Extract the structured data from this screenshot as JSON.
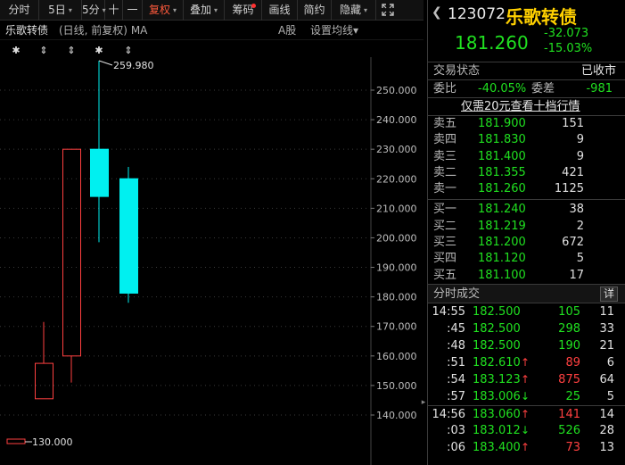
{
  "toolbar": {
    "items": [
      {
        "label": "分时",
        "has_arrow": false
      },
      {
        "label": "5日",
        "has_arrow": true
      },
      {
        "label": "5分",
        "has_arrow": true
      },
      {
        "label": "十",
        "has_arrow": false
      },
      {
        "label": "一",
        "has_arrow": false
      },
      {
        "label": "复权",
        "has_arrow": true,
        "active": true
      },
      {
        "label": "叠加",
        "has_arrow": true
      },
      {
        "label": "筹码",
        "has_arrow": false,
        "dot": true
      },
      {
        "label": "画线",
        "has_arrow": false
      },
      {
        "label": "简约",
        "has_arrow": false
      },
      {
        "label": "隐藏",
        "has_arrow": true
      }
    ],
    "fullscreen_icon": "expand-icon"
  },
  "infobar": {
    "name": "乐歌转债",
    "params": "(日线, 前复权)",
    "indicator": "MA",
    "share_type": "A股",
    "settings": "设置均线",
    "settings_arrow": "▾"
  },
  "chart_data": {
    "type": "candlestick",
    "y_ticks": [
      "250.000",
      "240.000",
      "230.000",
      "220.000",
      "210.000",
      "200.000",
      "190.000",
      "180.000",
      "170.000",
      "160.000",
      "150.000",
      "140.000"
    ],
    "y_tick_values": [
      250,
      240,
      230,
      220,
      210,
      200,
      190,
      180,
      170,
      160,
      150,
      140
    ],
    "candles": [
      {
        "open": 145.5,
        "close": 157.5,
        "high": 171.5,
        "low": 145.5,
        "dir": "up"
      },
      {
        "open": 160.0,
        "close": 230.0,
        "high": 230.0,
        "low": 151.0,
        "dir": "up"
      },
      {
        "open": 230.0,
        "close": 214.0,
        "high": 259.98,
        "low": 198.5,
        "dir": "down"
      },
      {
        "open": 220.0,
        "close": 181.26,
        "high": 224.0,
        "low": 178.0,
        "dir": "down"
      }
    ],
    "high_label": "259.980",
    "low_label": "130.000",
    "markers": [
      "✱",
      "⇕",
      "⇕",
      "✱",
      "⇕"
    ]
  },
  "quote": {
    "code": "123072",
    "name": "乐歌转债",
    "price": "181.260",
    "change": "-32.073",
    "change_pct": "-15.03%"
  },
  "status": {
    "label": "交易状态",
    "value": "已收市",
    "ratio_label": "委比",
    "ratio_value": "-40.05%",
    "diff_label": "委差",
    "diff_value": "-981"
  },
  "promo": "仅需20元查看十档行情",
  "order_book": {
    "asks": [
      {
        "label": "卖五",
        "price": "181.900",
        "vol": "151"
      },
      {
        "label": "卖四",
        "price": "181.830",
        "vol": "9"
      },
      {
        "label": "卖三",
        "price": "181.400",
        "vol": "9"
      },
      {
        "label": "卖二",
        "price": "181.355",
        "vol": "421"
      },
      {
        "label": "卖一",
        "price": "181.260",
        "vol": "1125"
      }
    ],
    "bids": [
      {
        "label": "买一",
        "price": "181.240",
        "vol": "38"
      },
      {
        "label": "买二",
        "price": "181.219",
        "vol": "2"
      },
      {
        "label": "买三",
        "price": "181.200",
        "vol": "672"
      },
      {
        "label": "买四",
        "price": "181.120",
        "vol": "5"
      },
      {
        "label": "买五",
        "price": "181.100",
        "vol": "17"
      }
    ]
  },
  "ticks": {
    "title": "分时成交",
    "detail": "详",
    "rows": [
      {
        "time": "14:55",
        "price": "182.500",
        "arrow": "",
        "vol": "105",
        "dir": "dn",
        "num": "11"
      },
      {
        "time": ":45",
        "price": "182.500",
        "arrow": "",
        "vol": "298",
        "dir": "dn",
        "num": "33"
      },
      {
        "time": ":48",
        "price": "182.500",
        "arrow": "",
        "vol": "190",
        "dir": "dn",
        "num": "21"
      },
      {
        "time": ":51",
        "price": "182.610",
        "arrow": "↑",
        "vol": "89",
        "dir": "up",
        "num": "6"
      },
      {
        "time": ":54",
        "price": "183.123",
        "arrow": "↑",
        "vol": "875",
        "dir": "up",
        "num": "64"
      },
      {
        "time": ":57",
        "price": "183.006",
        "arrow": "↓",
        "vol": "25",
        "dir": "dn",
        "num": "5"
      },
      {
        "time": "14:56",
        "price": "183.060",
        "arrow": "↑",
        "vol": "141",
        "dir": "up",
        "num": "14"
      },
      {
        "time": ":03",
        "price": "183.012",
        "arrow": "↓",
        "vol": "526",
        "dir": "dn",
        "num": "28"
      },
      {
        "time": ":06",
        "price": "183.400",
        "arrow": "↑",
        "vol": "73",
        "dir": "up",
        "num": "13"
      }
    ]
  },
  "colors": {
    "up": "#ff4040",
    "down": "#00f0f0",
    "green": "#20e020",
    "name_yellow": "#ffd000",
    "active": "#ff5a3c"
  }
}
